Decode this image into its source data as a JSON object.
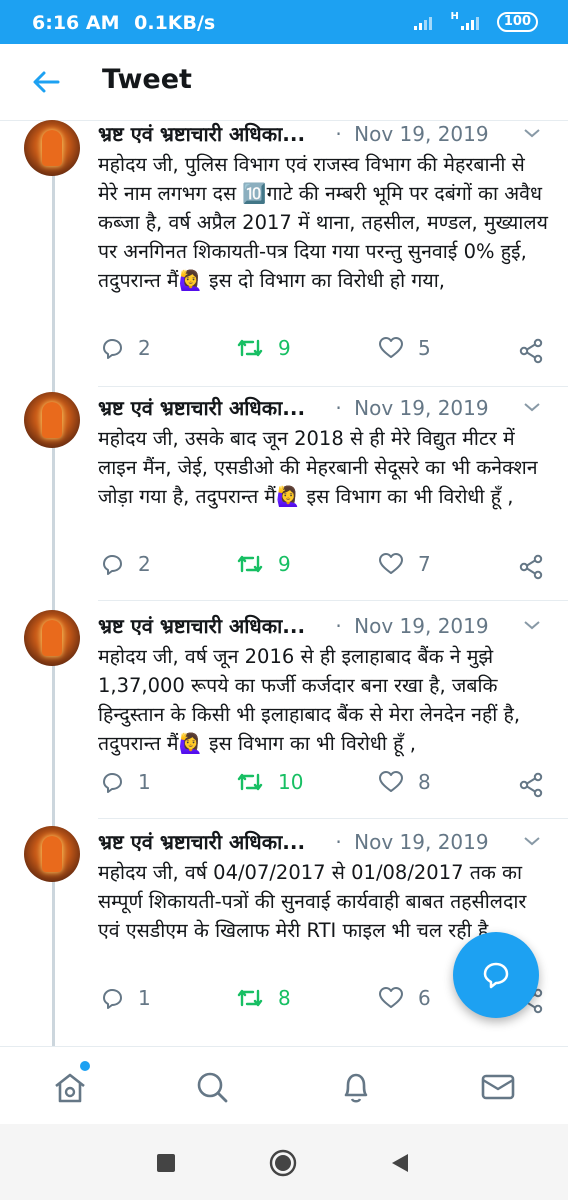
{
  "status_bar": {
    "time": "6:16 AM",
    "speed": "0.1KB/s",
    "network": "H",
    "battery": "100"
  },
  "app_bar": {
    "title": "Tweet"
  },
  "tweets": [
    {
      "author": "भ्रष्ट एवं भ्रष्टाचारी अधिका...",
      "separator": "·",
      "date": "Nov 19, 2019",
      "text": "महोदय जी, पुलिस विभाग एवं राजस्व विभाग की मेहरबानी से मेरे नाम लगभग दस 🔟गाटे की नम्बरी भूमि पर दबंगों का अवैध कब्जा है, वर्ष अप्रैल 2017 में थाना, तहसील, मण्डल, मुख्यालय पर अनगिनत शिकायती-पत्र दिया गया परन्तु सुनवाई 0% हुई, तदुपरान्त मैं🙋‍♀️ इस दो विभाग का विरोधी हो गया,",
      "replies": "2",
      "retweets": "9",
      "likes": "5"
    },
    {
      "author": "भ्रष्ट एवं भ्रष्टाचारी अधिका...",
      "separator": "·",
      "date": "Nov 19, 2019",
      "text": "महोदय जी, उसके बाद जून 2018 से ही मेरे विद्युत मीटर में लाइन मैंन, जेई, एसडीओ की मेहरबानी सेदूसरे का भी कनेक्शन जोड़ा गया है, तदुपरान्त मैं🙋‍♀️ इस विभाग का भी विरोधी हूँ ,",
      "replies": "2",
      "retweets": "9",
      "likes": "7"
    },
    {
      "author": "भ्रष्ट एवं भ्रष्टाचारी अधिका...",
      "separator": "·",
      "date": "Nov 19, 2019",
      "text": "महोदय जी, वर्ष जून 2016 से ही इलाहाबाद बैंक ने मुझे 1,37,000 रूपये का फर्जी कर्जदार बना रखा है, जबकि हिन्दुस्तान के किसी भी इलाहाबाद बैंक से मेरा लेनदेन नहीं है, तदुपरान्त मैं🙋‍♀️ इस विभाग का भी विरोधी हूँ ,",
      "replies": "1",
      "retweets": "10",
      "likes": "8"
    },
    {
      "author": "भ्रष्ट एवं भ्रष्टाचारी अधिका...",
      "separator": "·",
      "date": "Nov 19, 2019",
      "text": "महोदय जी, वर्ष 04/07/2017 से 01/08/2017 तक का सम्पूर्ण शिकायती-पत्रों की सुनवाई कार्यवाही बाबत तहसीलदार एवं एसडीएम के खिलाफ मेरी RTI फाइल भी चल रही है,",
      "replies": "1",
      "retweets": "8",
      "likes": "6"
    }
  ],
  "colors": {
    "accent": "#1da1f2",
    "retweet": "#17bf63",
    "muted": "#657786"
  },
  "icons": {
    "bottom_nav": [
      "home-icon",
      "search-icon",
      "notifications-icon",
      "messages-icon"
    ],
    "fab": "compose-reply-icon",
    "system_nav": [
      "recents-icon",
      "home-circle-icon",
      "back-triangle-icon"
    ]
  }
}
